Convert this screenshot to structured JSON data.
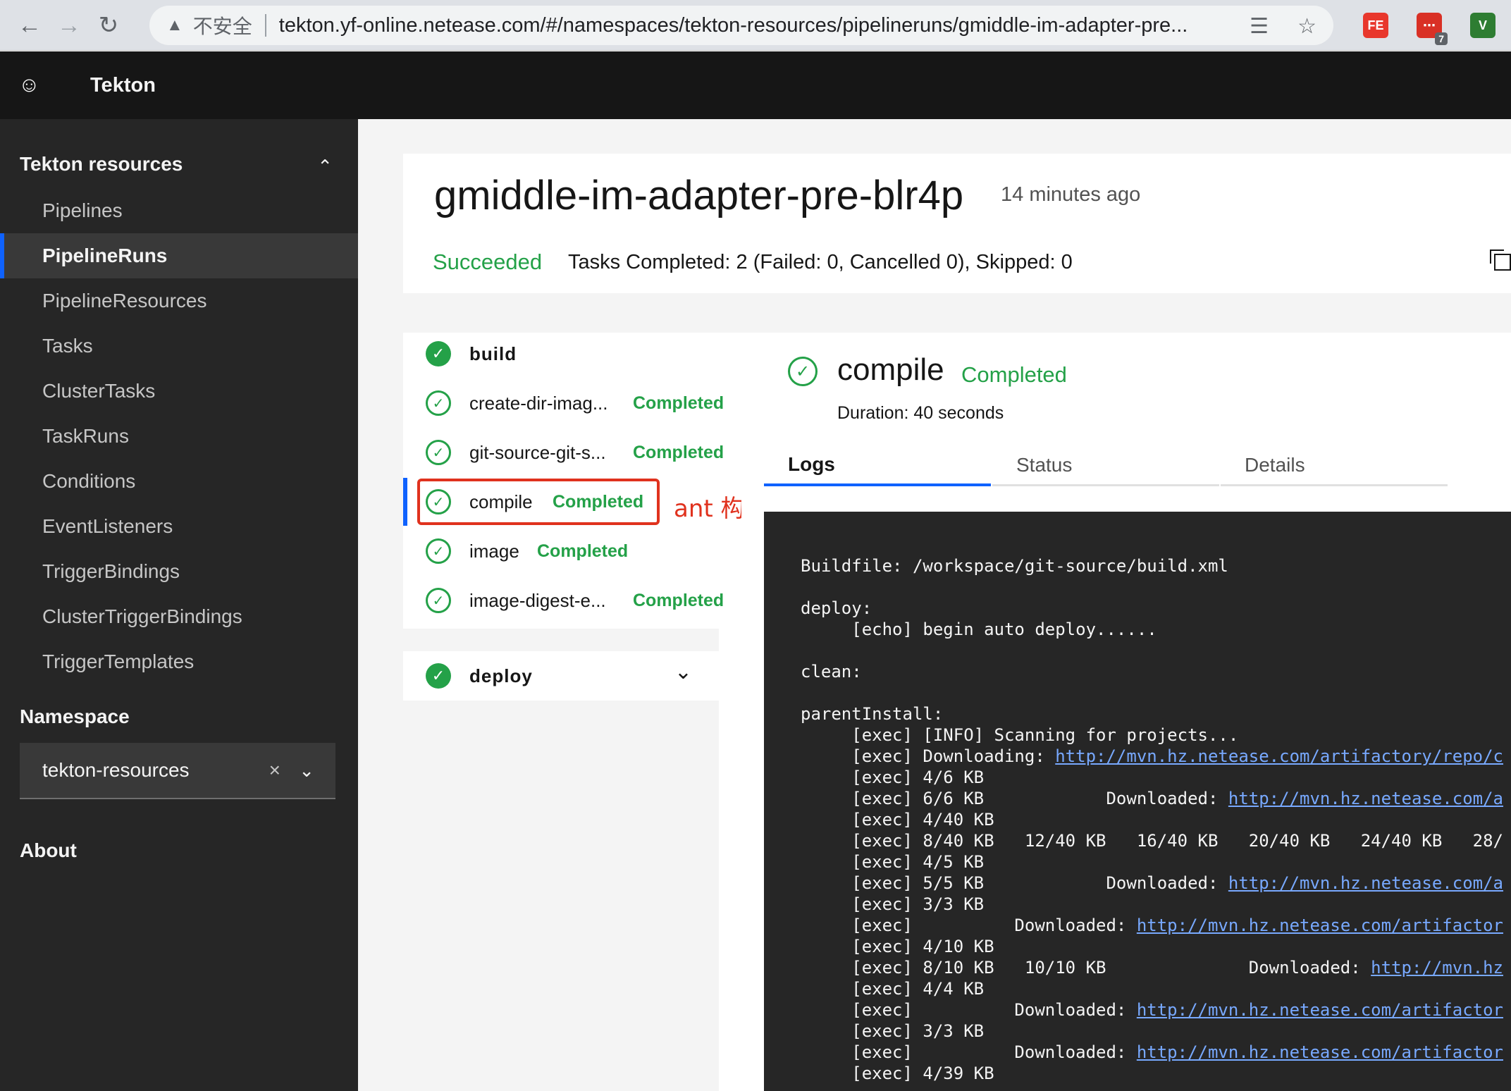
{
  "browser": {
    "insecure_label": "不安全",
    "url": "tekton.yf-online.netease.com/#/namespaces/tekton-resources/pipelineruns/gmiddle-im-adapter-pre...",
    "ext_badge": "7",
    "ext_fe": "FE",
    "ext_v": "V"
  },
  "app": {
    "title": "Tekton"
  },
  "sidebar": {
    "section_title": "Tekton resources",
    "items": [
      {
        "label": "Pipelines"
      },
      {
        "label": "PipelineRuns"
      },
      {
        "label": "PipelineResources"
      },
      {
        "label": "Tasks"
      },
      {
        "label": "ClusterTasks"
      },
      {
        "label": "TaskRuns"
      },
      {
        "label": "Conditions"
      },
      {
        "label": "EventListeners"
      },
      {
        "label": "TriggerBindings"
      },
      {
        "label": "ClusterTriggerBindings"
      },
      {
        "label": "TriggerTemplates"
      }
    ],
    "active_item": "PipelineRuns",
    "namespace_title": "Namespace",
    "namespace_value": "tekton-resources",
    "about": "About"
  },
  "run": {
    "name": "gmiddle-im-adapter-pre-blr4p",
    "age": "14 minutes ago",
    "status": "Succeeded",
    "summary": "Tasks Completed: 2 (Failed: 0, Cancelled 0), Skipped: 0"
  },
  "tasks": [
    {
      "name": "build",
      "steps": [
        {
          "name": "create-dir-imag...",
          "status": "Completed"
        },
        {
          "name": "git-source-git-s...",
          "status": "Completed"
        },
        {
          "name": "compile",
          "status": "Completed"
        },
        {
          "name": "image",
          "status": "Completed"
        },
        {
          "name": "image-digest-e...",
          "status": "Completed"
        }
      ]
    },
    {
      "name": "deploy"
    }
  ],
  "annotation": "ant 构建步骤",
  "step_detail": {
    "name": "compile",
    "status": "Completed",
    "duration": "Duration: 40 seconds",
    "tabs": [
      {
        "label": "Logs"
      },
      {
        "label": "Status"
      },
      {
        "label": "Details"
      }
    ],
    "active_tab": "Logs"
  },
  "logs": [
    {
      "text": "Buildfile: /workspace/git-source/build.xml",
      "link": ""
    },
    {
      "text": "",
      "link": ""
    },
    {
      "text": "deploy:",
      "link": ""
    },
    {
      "text": "     [echo] begin auto deploy......",
      "link": ""
    },
    {
      "text": "",
      "link": ""
    },
    {
      "text": "clean:",
      "link": ""
    },
    {
      "text": "",
      "link": ""
    },
    {
      "text": "parentInstall:",
      "link": ""
    },
    {
      "text": "     [exec] [INFO] Scanning for projects...",
      "link": ""
    },
    {
      "text": "     [exec] Downloading: ",
      "link": "http://mvn.hz.netease.com/artifactory/repo/c"
    },
    {
      "text": "     [exec] 4/6 KB",
      "link": ""
    },
    {
      "text": "     [exec] 6/6 KB            Downloaded: ",
      "link": "http://mvn.hz.netease.com/a"
    },
    {
      "text": "     [exec] 4/40 KB",
      "link": ""
    },
    {
      "text": "     [exec] 8/40 KB   12/40 KB   16/40 KB   20/40 KB   24/40 KB   28/",
      "link": ""
    },
    {
      "text": "     [exec] 4/5 KB",
      "link": ""
    },
    {
      "text": "     [exec] 5/5 KB            Downloaded: ",
      "link": "http://mvn.hz.netease.com/a"
    },
    {
      "text": "     [exec] 3/3 KB",
      "link": ""
    },
    {
      "text": "     [exec]          Downloaded: ",
      "link": "http://mvn.hz.netease.com/artifactor"
    },
    {
      "text": "     [exec] 4/10 KB",
      "link": ""
    },
    {
      "text": "     [exec] 8/10 KB   10/10 KB              Downloaded: ",
      "link": "http://mvn.hz"
    },
    {
      "text": "     [exec] 4/4 KB",
      "link": ""
    },
    {
      "text": "     [exec]          Downloaded: ",
      "link": "http://mvn.hz.netease.com/artifactor"
    },
    {
      "text": "     [exec] 3/3 KB",
      "link": ""
    },
    {
      "text": "     [exec]          Downloaded: ",
      "link": "http://mvn.hz.netease.com/artifactor"
    },
    {
      "text": "     [exec] 4/39 KB",
      "link": ""
    }
  ],
  "colors": {
    "success": "#24a148",
    "accent": "#0f62fe",
    "annotation": "#e0321e",
    "link": "#78a9ff"
  },
  "icons": [
    "back-icon",
    "forward-icon",
    "reload-icon",
    "warning-icon",
    "translate-icon",
    "star-icon",
    "tekton-logo-icon",
    "chevron-up-icon",
    "clear-icon",
    "chevron-down-icon",
    "copy-icon",
    "check-circle-icon"
  ]
}
